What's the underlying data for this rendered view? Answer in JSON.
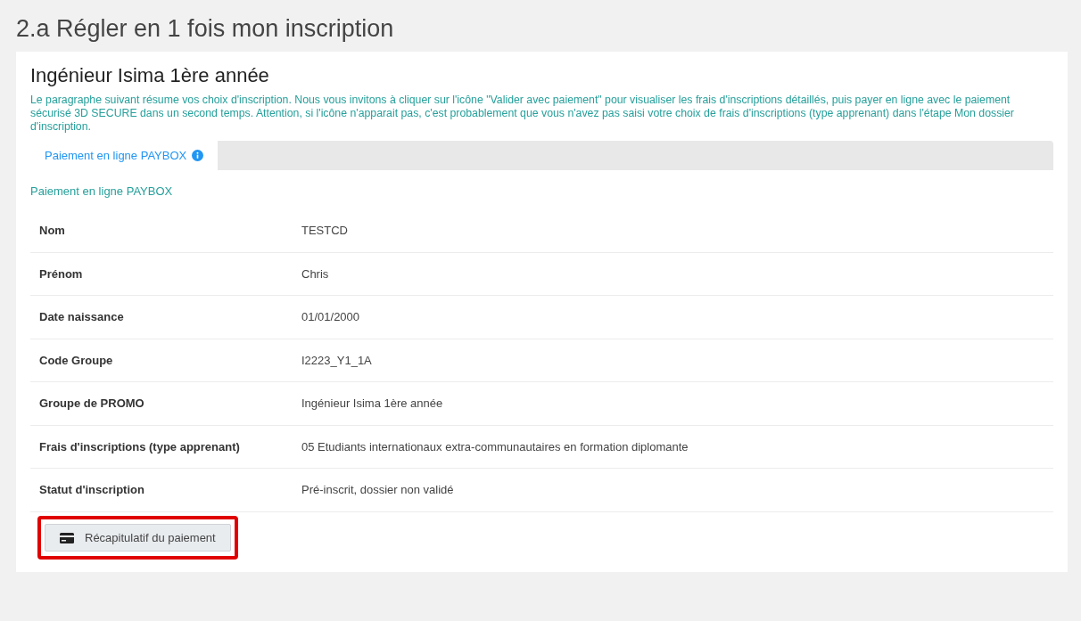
{
  "page_title": "2.a Régler en 1 fois mon inscription",
  "card": {
    "title": "Ingénieur Isima 1ère année",
    "intro": "Le paragraphe suivant résume vos choix d'inscription. Nous vous invitons à cliquer sur l'icône \"Valider avec paiement\" pour visualiser les frais d'inscriptions détaillés, puis payer en ligne avec le paiement sécurisé 3D SECURE dans un second temps. Attention, si l'icône n'apparait pas, c'est probablement que vous n'avez pas saisi votre choix de frais d'inscriptions (type apprenant) dans l'étape  Mon dossier d'inscription.",
    "tabs": [
      {
        "label": "Paiement en ligne PAYBOX",
        "selected": true
      }
    ],
    "section_label": "Paiement en ligne PAYBOX",
    "rows": [
      {
        "label": "Nom",
        "value": "TESTCD"
      },
      {
        "label": "Prénom",
        "value": "Chris"
      },
      {
        "label": "Date naissance",
        "value": "01/01/2000"
      },
      {
        "label": "Code Groupe",
        "value": "I2223_Y1_1A"
      },
      {
        "label": "Groupe de PROMO",
        "value": "Ingénieur Isima 1ère année"
      },
      {
        "label": "Frais d'inscriptions (type apprenant)",
        "value": "05 Etudiants internationaux extra-communautaires en formation diplomante"
      },
      {
        "label": "Statut d'inscription",
        "value": "Pré-inscrit, dossier non validé"
      }
    ],
    "button": {
      "label": "Récapitulatif du paiement",
      "highlighted": true
    }
  }
}
